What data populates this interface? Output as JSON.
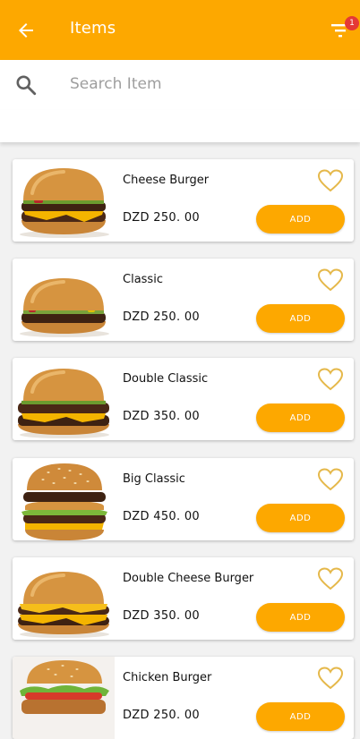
{
  "appbar": {
    "title": "Items",
    "filter_badge": "1"
  },
  "search": {
    "placeholder": "Search Item"
  },
  "items": [
    {
      "name": "Cheese Burger",
      "price": "DZD 250. 00",
      "add_label": "ADD"
    },
    {
      "name": "Classic",
      "price": "DZD 250. 00",
      "add_label": "ADD"
    },
    {
      "name": "Double Classic",
      "price": "DZD 350. 00",
      "add_label": "ADD"
    },
    {
      "name": "Big Classic",
      "price": "DZD 450. 00",
      "add_label": "ADD"
    },
    {
      "name": "Double Cheese Burger",
      "price": "DZD 350. 00",
      "add_label": "ADD"
    },
    {
      "name": "Chicken Burger",
      "price": "DZD 250. 00",
      "add_label": "ADD"
    }
  ],
  "colors": {
    "accent": "#FDA800",
    "badge": "#E53935",
    "heart": "#E5B84A"
  },
  "icons": {
    "back": "arrow-left-icon",
    "filter": "filter-icon",
    "search": "search-icon",
    "favorite": "heart-outline-icon"
  }
}
